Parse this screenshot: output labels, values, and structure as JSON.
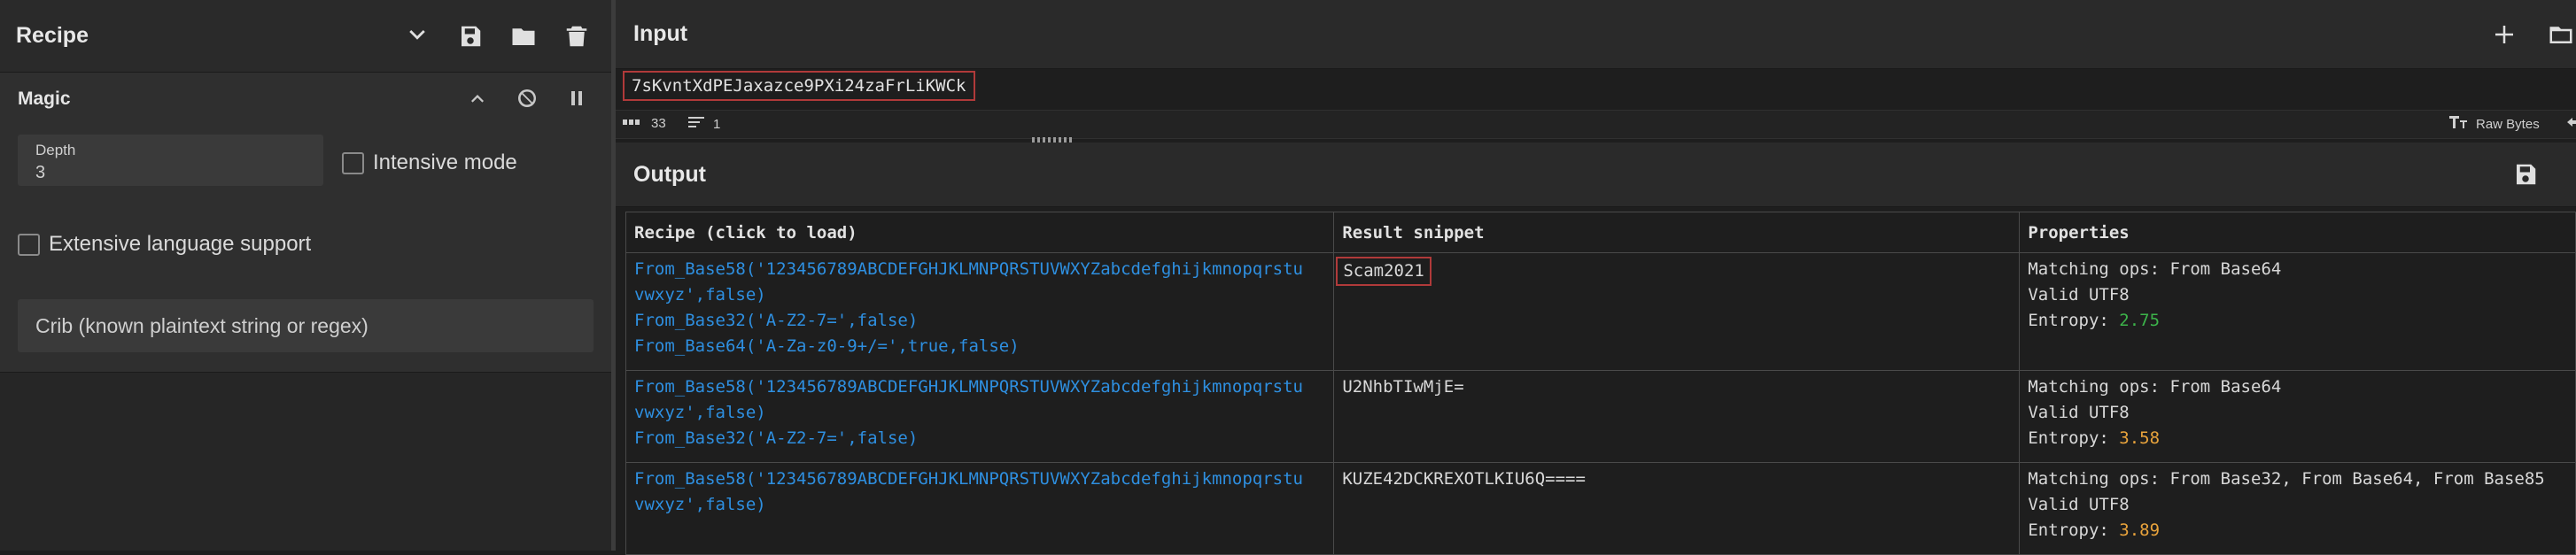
{
  "recipe": {
    "title": "Recipe",
    "operation": {
      "name": "Magic",
      "depth_label": "Depth",
      "depth_value": "3",
      "intensive_mode_label": "Intensive mode",
      "extensive_language_label": "Extensive language support",
      "crib_placeholder": "Crib (known plaintext string or regex)"
    }
  },
  "input": {
    "title": "Input",
    "text": "7sKvntXdPEJaxazce9PXi24zaFrLiKWCk",
    "status": {
      "length": "33",
      "lines": "1",
      "raw_bytes_label": "Raw Bytes"
    }
  },
  "output": {
    "title": "Output",
    "headers": [
      "Recipe (click to load)",
      "Result snippet",
      "Properties"
    ],
    "rows": [
      {
        "recipe": [
          "From_Base58('123456789ABCDEFGHJKLMNPQRSTUVWXYZabcdefghijkmnopqrstu",
          "vwxyz',false)",
          "From_Base32('A-Z2-7=',false)",
          "From_Base64('A-Za-z0-9+/=',true,false)"
        ],
        "snippet": "Scam2021",
        "matching": "Matching ops: From Base64",
        "valid": "Valid UTF8",
        "entropy_label": "Entropy: ",
        "entropy": "2.75"
      },
      {
        "recipe": [
          "From_Base58('123456789ABCDEFGHJKLMNPQRSTUVWXYZabcdefghijkmnopqrstu",
          "vwxyz',false)",
          "From_Base32('A-Z2-7=',false)"
        ],
        "snippet": "U2NhbTIwMjE=",
        "matching": "Matching ops: From Base64",
        "valid": "Valid UTF8",
        "entropy_label": "Entropy: ",
        "entropy": "3.58"
      },
      {
        "recipe": [
          "From_Base58('123456789ABCDEFGHJKLMNPQRSTUVWXYZabcdefghijkmnopqrstu",
          "vwxyz',false)"
        ],
        "snippet": "KUZE42DCKREXOTLKIU6Q====",
        "matching": "Matching ops: From Base32, From Base64, From Base85",
        "valid": "Valid UTF8",
        "entropy_label": "Entropy: ",
        "entropy": "3.89"
      }
    ]
  },
  "icons": [
    "chevron-down-icon",
    "save-icon",
    "folder-icon",
    "trash-icon",
    "chevron-up-icon",
    "disable-icon",
    "pause-icon",
    "plus-icon",
    "folder-icon",
    "abc-icon",
    "lines-icon",
    "text-format-icon",
    "arrow-left-icon",
    "save-icon"
  ],
  "colors": {
    "highlight_border": "#b03a3a",
    "link_blue": "#2e8fe0",
    "entropy_low": "#3cb34a",
    "entropy_mid": "#e8a33c"
  }
}
